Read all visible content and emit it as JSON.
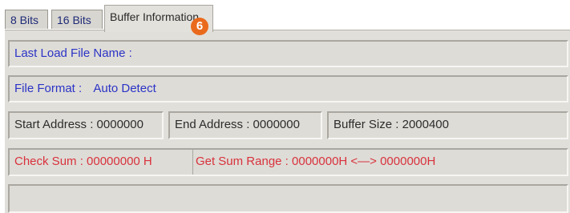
{
  "tabs": [
    {
      "label": "8 Bits"
    },
    {
      "label": "16 Bits"
    },
    {
      "label": "Buffer Information"
    }
  ],
  "callout_badge": "6",
  "fields": {
    "last_load_file_name": "Last Load File Name :",
    "file_format_label": "File Format :",
    "file_format_value": "Auto Detect",
    "start_address": "Start Address : 0000000",
    "end_address": "End Address : 0000000",
    "buffer_size": "Buffer Size : 2000400",
    "check_sum": "Check Sum : 00000000 H",
    "get_sum_range": "Get Sum Range : 0000000H <—> 0000000H",
    "empty_status": ""
  },
  "colors": {
    "label_blue": "#2b34c6",
    "label_red": "#d8323c",
    "badge_orange": "#ea6a1d",
    "panel_gray": "#e1dfda"
  }
}
